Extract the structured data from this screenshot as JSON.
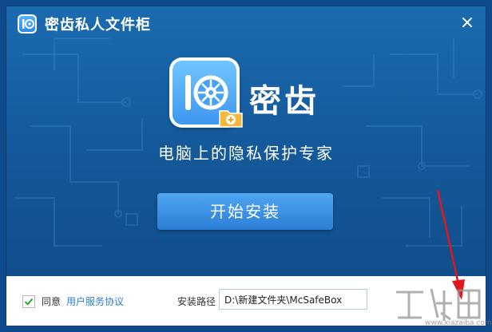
{
  "window": {
    "title": "密齿私人文件柜",
    "close_glyph": "×"
  },
  "hero": {
    "brand_name": "密齿",
    "slogan": "电脑上的隐私保护专家"
  },
  "actions": {
    "install_label": "开始安装"
  },
  "footer": {
    "agree_checked": true,
    "agree_label": "同意",
    "agreement_link": "用户服务协议",
    "path_label": "安装路径",
    "path_value": "D:\\新建文件夹\\McSafeBox"
  },
  "watermark": {
    "text": "www.xiazaiba.com"
  },
  "colors": {
    "window_bg": "#1b6bb0",
    "button_bg": "#3a8ee4",
    "link": "#2a7fd4",
    "arrow": "#e0171b",
    "check": "#2fa531"
  },
  "icons": {
    "app": "safe-box-icon",
    "folder_badge": "folder-add-icon",
    "close": "close-icon",
    "check": "check-icon"
  }
}
